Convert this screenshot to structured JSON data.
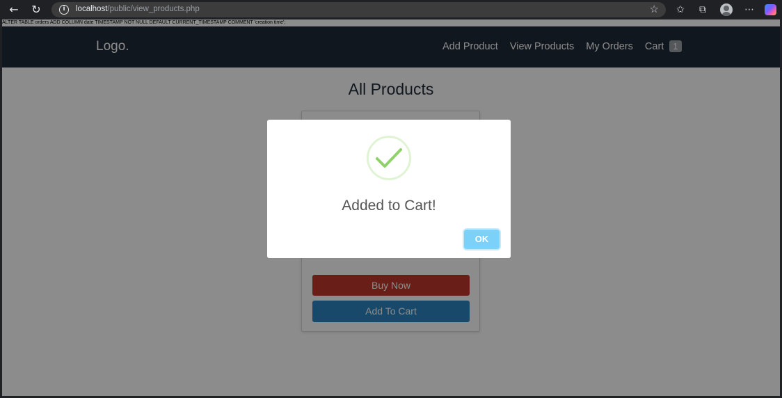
{
  "browser": {
    "url_host": "localhost",
    "url_path": "/public/view_products.php"
  },
  "sql_message": "ALTER TABLE orders ADD COLUMN date TIMESTAMP NOT NULL DEFAULT CURRENT_TIMESTAMP COMMENT 'creation time';",
  "site": {
    "logo": "Logo.",
    "nav": {
      "add_product": "Add Product",
      "view_products": "View Products",
      "my_orders": "My Orders",
      "cart": "Cart",
      "cart_count": "1"
    }
  },
  "main": {
    "title": "All Products",
    "card": {
      "buy_now": "Buy Now",
      "add_to_cart": "Add To Cart"
    }
  },
  "modal": {
    "title": "Added to Cart!",
    "ok": "OK"
  },
  "colors": {
    "navbar": "#1f2a38",
    "buy_now": "#c0392b",
    "add_to_cart": "#2e86c1",
    "ok_button": "#7cd1f9",
    "success": "#a5dc86"
  }
}
